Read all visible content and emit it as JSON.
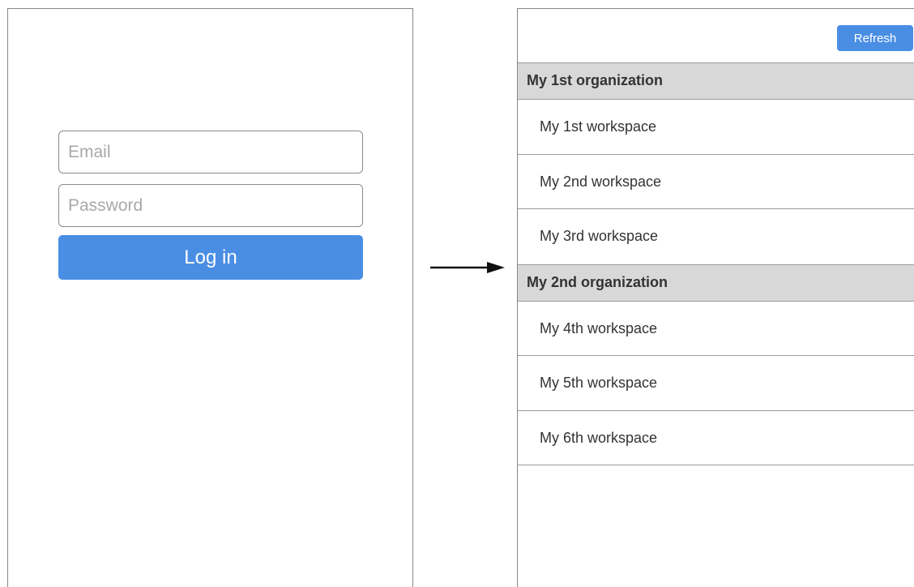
{
  "login": {
    "email_placeholder": "Email",
    "password_placeholder": "Password",
    "login_label": "Log in"
  },
  "workspaces": {
    "refresh_label": "Refresh",
    "organizations": [
      {
        "name": "My 1st organization",
        "workspaces": [
          "My 1st workspace",
          "My 2nd workspace",
          "My 3rd workspace"
        ]
      },
      {
        "name": "My 2nd organization",
        "workspaces": [
          "My 4th workspace",
          "My 5th workspace",
          "My 6th workspace"
        ]
      }
    ]
  },
  "colors": {
    "accent": "#4a8ee4",
    "org_header_bg": "#d8d8d8",
    "border": "#888888"
  },
  "icons": {
    "flow_arrow": "right-arrow-icon"
  }
}
